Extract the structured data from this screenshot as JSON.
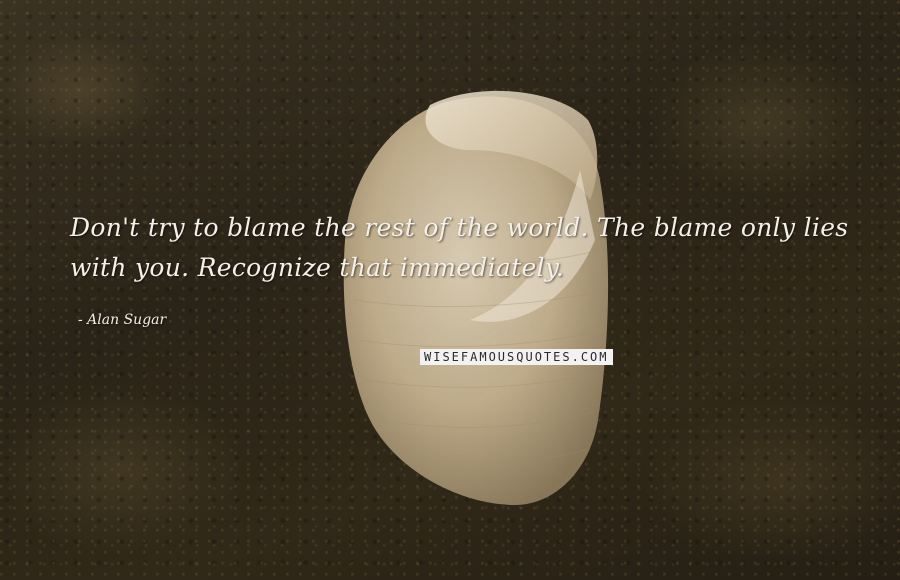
{
  "quote": {
    "text": "Don't try to blame the rest of the world. The blame only lies with you. Recognize that immediately.",
    "author": "- Alan Sugar"
  },
  "watermark": {
    "text": "WISEFAMOUSQUOTES.COM"
  },
  "background": {
    "subject": "seashell-on-rock",
    "shell_color": "#d8c7a8",
    "rock_color": "#2b2418"
  }
}
